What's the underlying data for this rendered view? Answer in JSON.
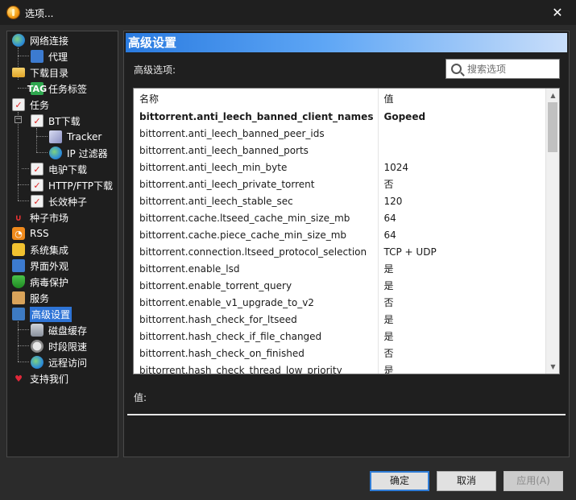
{
  "window": {
    "title": "选项..."
  },
  "tree": [
    {
      "label": "网络连接",
      "icon": "globe-icon"
    },
    {
      "label": "代理",
      "icon": "globe-icon"
    },
    {
      "label": "下载目录",
      "icon": "folder-icon"
    },
    {
      "label": "任务标签",
      "icon": "tag-icon",
      "icon_text": "TAG"
    },
    {
      "label": "任务",
      "icon": "clipboard-icon"
    },
    {
      "label": "BT下载",
      "icon": "clipboard-icon"
    },
    {
      "label": "Tracker",
      "icon": "cube-icon"
    },
    {
      "label": "IP 过滤器",
      "icon": "globe-icon"
    },
    {
      "label": "电驴下载",
      "icon": "clipboard-icon"
    },
    {
      "label": "HTTP/FTP下载",
      "icon": "clipboard-icon"
    },
    {
      "label": "长效种子",
      "icon": "clipboard-icon"
    },
    {
      "label": "种子市场",
      "icon": "magnet-icon"
    },
    {
      "label": "RSS",
      "icon": "rss-icon"
    },
    {
      "label": "系统集成",
      "icon": "puzzle-icon"
    },
    {
      "label": "界面外观",
      "icon": "palette-icon"
    },
    {
      "label": "病毒保护",
      "icon": "shield-icon"
    },
    {
      "label": "服务",
      "icon": "service-icon"
    },
    {
      "label": "高级设置",
      "icon": "advanced-icon",
      "selected": true
    },
    {
      "label": "磁盘缓存",
      "icon": "disk-icon"
    },
    {
      "label": "时段限速",
      "icon": "timer-icon"
    },
    {
      "label": "远程访问",
      "icon": "remote-icon"
    },
    {
      "label": "支持我们",
      "icon": "heart-icon"
    }
  ],
  "panel": {
    "header": "高级设置",
    "section_label": "高级选项:",
    "search_placeholder": "搜索选项",
    "columns": {
      "name": "名称",
      "value": "值"
    },
    "rows": [
      {
        "name": "bittorrent.anti_leech_banned_client_names",
        "value": "Gopeed",
        "bold": true
      },
      {
        "name": "bittorrent.anti_leech_banned_peer_ids",
        "value": ""
      },
      {
        "name": "bittorrent.anti_leech_banned_ports",
        "value": ""
      },
      {
        "name": "bittorrent.anti_leech_min_byte",
        "value": "1024"
      },
      {
        "name": "bittorrent.anti_leech_private_torrent",
        "value": "否"
      },
      {
        "name": "bittorrent.anti_leech_stable_sec",
        "value": "120"
      },
      {
        "name": "bittorrent.cache.ltseed_cache_min_size_mb",
        "value": "64"
      },
      {
        "name": "bittorrent.cache.piece_cache_min_size_mb",
        "value": "64"
      },
      {
        "name": "bittorrent.connection.ltseed_protocol_selection",
        "value": "TCP + UDP"
      },
      {
        "name": "bittorrent.enable_lsd",
        "value": "是"
      },
      {
        "name": "bittorrent.enable_torrent_query",
        "value": "是"
      },
      {
        "name": "bittorrent.enable_v1_upgrade_to_v2",
        "value": "否"
      },
      {
        "name": "bittorrent.hash_check_for_ltseed",
        "value": "是"
      },
      {
        "name": "bittorrent.hash_check_if_file_changed",
        "value": "是"
      },
      {
        "name": "bittorrent.hash_check_on_finished",
        "value": "否"
      },
      {
        "name": "bittorrent.hash_check_thread_low_priority",
        "value": "是"
      }
    ],
    "value_label": "值:"
  },
  "buttons": {
    "ok": "确定",
    "cancel": "取消",
    "apply": "应用(A)"
  },
  "colors": {
    "selection": "#2e74d6",
    "header_gradient_start": "#2a7be0",
    "accent_border": "#2f7cd6"
  }
}
